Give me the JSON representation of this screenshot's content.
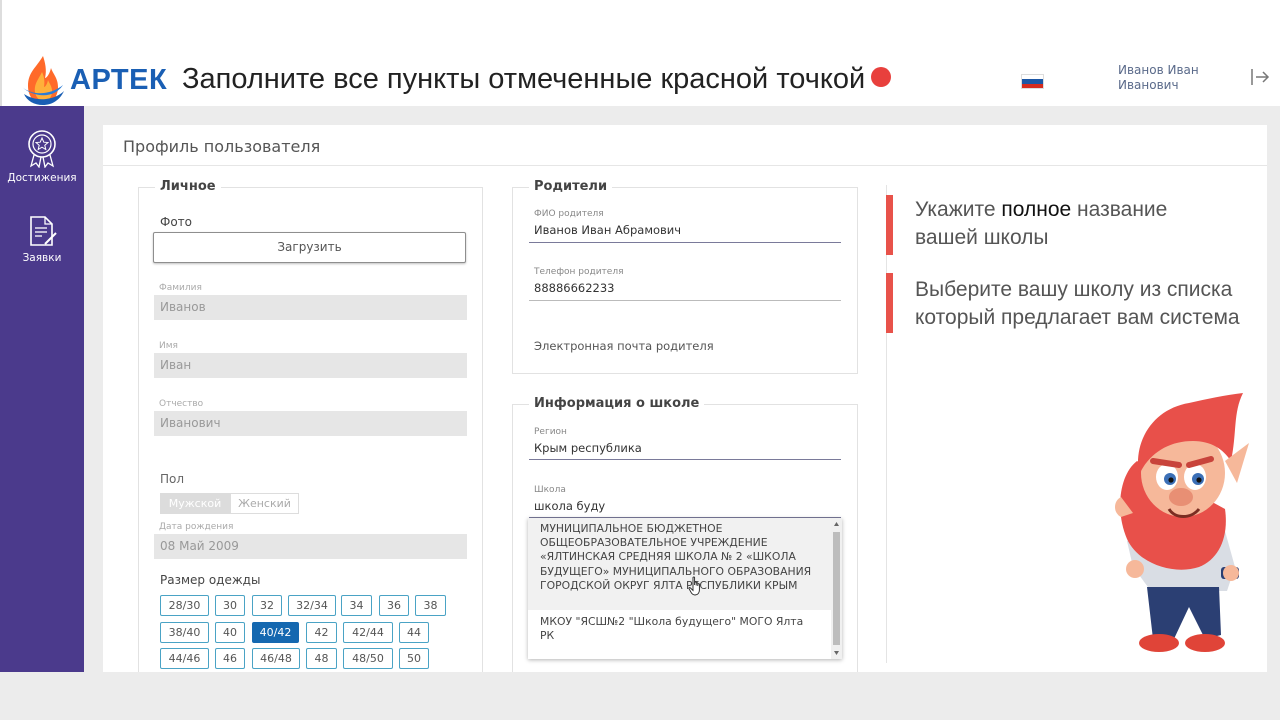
{
  "header": {
    "brand": "АРТЕК",
    "instruction": "Заполните все пункты отмеченные красной точкой",
    "user_name": "Иванов Иван Иванович",
    "flag_colors": [
      "#ffffff",
      "#1c57a5",
      "#d52b1e"
    ],
    "logout_icon": "logout-icon"
  },
  "sidebar": {
    "items": [
      {
        "label": "Достижения",
        "icon": "medal-icon"
      },
      {
        "label": "Заявки",
        "icon": "document-edit-icon"
      }
    ]
  },
  "page": {
    "title": "Профиль пользователя"
  },
  "personal": {
    "legend": "Личное",
    "photo_label": "Фото",
    "upload_label": "Загрузить",
    "surname_label": "Фамилия",
    "surname_value": "Иванов",
    "name_label": "Имя",
    "name_value": "Иван",
    "patronymic_label": "Отчество",
    "patronymic_value": "Иванович",
    "gender_label": "Пол",
    "gender_options": [
      "Мужской",
      "Женский"
    ],
    "birth_label": "Дата рождения",
    "birth_value": "08 Май 2009",
    "size_label": "Размер одежды",
    "sizes": [
      "28/30",
      "30",
      "32",
      "32/34",
      "34",
      "36",
      "38",
      "38/40",
      "40",
      "40/42",
      "42",
      "42/44",
      "44",
      "44/46",
      "46",
      "46/48",
      "48",
      "48/50",
      "50"
    ],
    "selected_size": "40/42"
  },
  "parents": {
    "legend": "Родители",
    "fio_label": "ФИО родителя",
    "fio_value": "Иванов Иван Абрамович",
    "phone_label": "Телефон родителя",
    "phone_value": "88886662233",
    "email_placeholder": "Электронная почта родителя"
  },
  "school": {
    "legend": "Информация о школе",
    "region_label": "Регион",
    "region_value": "Крым республика",
    "school_label": "Школа",
    "school_value": "школа буду",
    "options": [
      "МУНИЦИПАЛЬНОЕ БЮДЖЕТНОЕ ОБЩЕОБРАЗОВАТЕЛЬНОЕ УЧРЕЖДЕНИЕ «ЯЛТИНСКАЯ СРЕДНЯЯ ШКОЛА № 2 «ШКОЛА БУДУЩЕГО» МУНИЦИПАЛЬНОГО ОБРАЗОВАНИЯ ГОРОДСКОЙ ОКРУГ ЯЛТА РЕСПУБЛИКИ КРЫМ",
      "МКОУ \"ЯСШ№2 \"Школа будущего\" МОГО Ялта РК"
    ],
    "hovered_option": 0
  },
  "hints": {
    "hint1_pre": "Укажите ",
    "hint1_bold": "полное",
    "hint1_post": " название вашей школы",
    "hint2": "Выберите вашу школу из списка который предлагает вам система",
    "accent": "#e8524a"
  }
}
